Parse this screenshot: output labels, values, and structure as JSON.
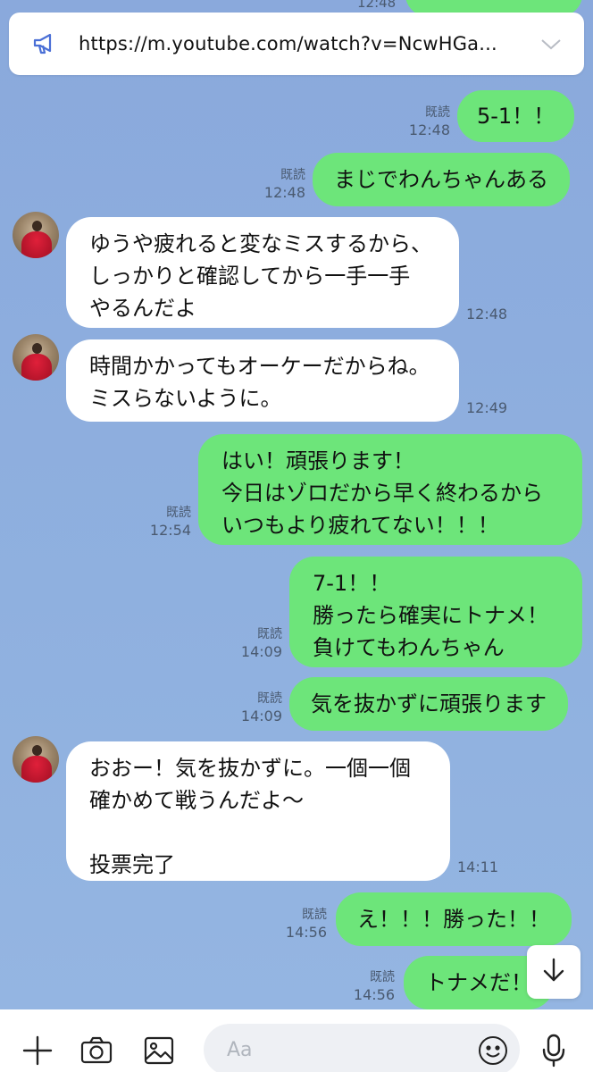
{
  "announcement": {
    "url": "https://m.youtube.com/watch?v=NcwHGa..."
  },
  "partial_top": {
    "time": "12:48"
  },
  "messages": [
    {
      "side": "me",
      "text": "5-1！！",
      "read": "既読",
      "time": "12:48"
    },
    {
      "side": "me",
      "text": "まじでわんちゃんある",
      "read": "既読",
      "time": "12:48"
    },
    {
      "side": "them",
      "text": "ゆうや疲れると変なミスするから、\nしっかりと確認してから一手一手\nやるんだよ",
      "time": "12:48"
    },
    {
      "side": "them",
      "text": "時間かかってもオーケーだからね。\nミスらないように。",
      "time": "12:49"
    },
    {
      "side": "me",
      "text": "はい！頑張ります！\n今日はゾロだから早く終わるから\nいつもより疲れてない！！！",
      "read": "既読",
      "time": "12:54"
    },
    {
      "side": "me",
      "text": "7-1！！\n勝ったら確実にトナメ！\n負けてもわんちゃん",
      "read": "既読",
      "time": "14:09"
    },
    {
      "side": "me",
      "text": "気を抜かずに頑張ります",
      "read": "既読",
      "time": "14:09"
    },
    {
      "side": "them",
      "text": "おおー！気を抜かずに。一個一個\n確かめて戦うんだよ〜\n\n投票完了",
      "time": "14:11"
    },
    {
      "side": "me",
      "text": "え！！！勝った！！",
      "read": "既読",
      "time": "14:56"
    },
    {
      "side": "me",
      "text": "トナメだ！",
      "read": "既読",
      "time": "14:56"
    }
  ],
  "input": {
    "placeholder": "Aa",
    "value": ""
  },
  "icons": {
    "announcement": "megaphone-icon",
    "expand": "chevron-down-icon",
    "scroll": "arrow-down-icon",
    "plus": "plus-icon",
    "camera": "camera-icon",
    "image": "image-icon",
    "emoji": "emoji-icon",
    "mic": "microphone-icon"
  },
  "colors": {
    "background": "#8aa9dc",
    "my_bubble": "#6de57a",
    "their_bubble": "#ffffff",
    "announce_icon": "#4a6fd6"
  }
}
